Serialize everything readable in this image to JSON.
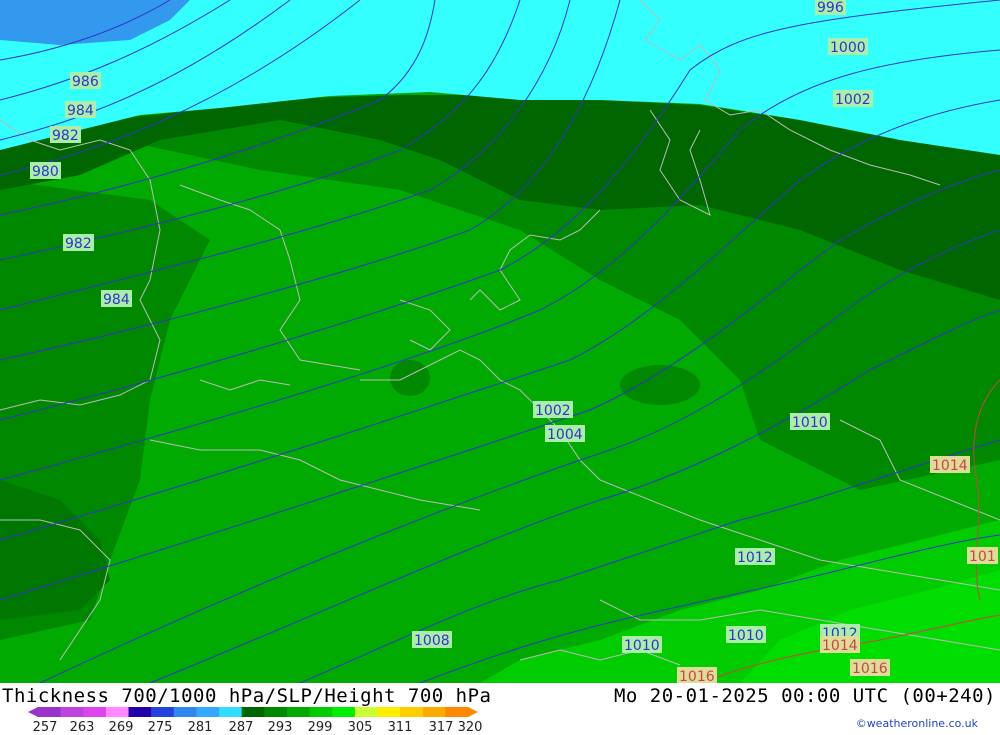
{
  "title_left": "Thickness 700/1000 hPa/SLP/Height 700 hPa",
  "title_right": "Mo 20-01-2025 00:00 UTC (00+240)",
  "credit": "©weatheronline.co.uk",
  "colors": {
    "sea_high": "#33ffff",
    "low_core": "#3399ee",
    "band_dark": "#006600",
    "band_mid": "#008800",
    "band_main": "#00aa00",
    "band_light": "#00cc00",
    "isobar": "#3333cc",
    "isobar_high": "#cc4444",
    "coast": "#bbbbbb"
  },
  "scale": {
    "colors": [
      "#9933cc",
      "#bb44dd",
      "#dd44ee",
      "#ff88ff",
      "#2200aa",
      "#2244dd",
      "#3388ee",
      "#33aaff",
      "#33ddff",
      "#006600",
      "#008800",
      "#00aa00",
      "#00cc00",
      "#00ee00",
      "#ccff33",
      "#ffee00",
      "#ffcc00",
      "#ffaa00",
      "#ff8800"
    ],
    "ticks": [
      "257",
      "263",
      "269",
      "275",
      "281",
      "287",
      "293",
      "299",
      "305",
      "311",
      "317",
      "320"
    ]
  },
  "isobar_labels": [
    {
      "id": "l-996",
      "text": "996",
      "high": false
    },
    {
      "id": "l-1000",
      "text": "1000",
      "high": false
    },
    {
      "id": "l-986",
      "text": "986",
      "high": false
    },
    {
      "id": "l-984a",
      "text": "984",
      "high": false
    },
    {
      "id": "l-982a",
      "text": "982",
      "high": false
    },
    {
      "id": "l-1002a",
      "text": "1002",
      "high": false
    },
    {
      "id": "l-980",
      "text": "980",
      "high": false
    },
    {
      "id": "l-982b",
      "text": "982",
      "high": false
    },
    {
      "id": "l-984b",
      "text": "984",
      "high": false
    },
    {
      "id": "l-1002b",
      "text": "1002",
      "high": false
    },
    {
      "id": "l-1004",
      "text": "1004",
      "high": false
    },
    {
      "id": "l-1010a",
      "text": "1010",
      "high": false
    },
    {
      "id": "l-1014a",
      "text": "1014",
      "high": true
    },
    {
      "id": "l-1012a",
      "text": "1012",
      "high": false
    },
    {
      "id": "l-101",
      "text": "101",
      "high": true
    },
    {
      "id": "l-1008",
      "text": "1008",
      "high": false
    },
    {
      "id": "l-1010b",
      "text": "1010",
      "high": false
    },
    {
      "id": "l-1010c",
      "text": "1010",
      "high": false
    },
    {
      "id": "l-1012b",
      "text": "1012",
      "high": false
    },
    {
      "id": "l-1014b",
      "text": "1014",
      "high": true
    },
    {
      "id": "l-1016a",
      "text": "1016",
      "high": true
    },
    {
      "id": "l-1016b",
      "text": "1016",
      "high": true
    }
  ]
}
